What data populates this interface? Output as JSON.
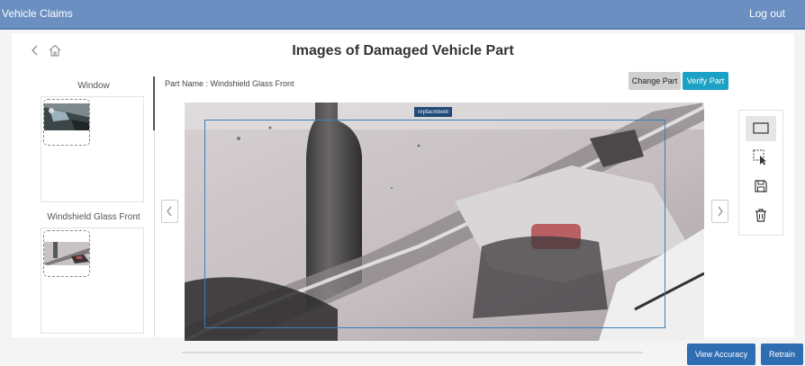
{
  "header": {
    "app_title": "Vehicle Claims",
    "logout_label": "Log out"
  },
  "page": {
    "title": "Images of Damaged Vehicle Part",
    "part_name": "Part Name : Windshield Glass Front"
  },
  "sidebar": {
    "groups": [
      {
        "label": "Window"
      },
      {
        "label": "Windshield Glass Front"
      }
    ]
  },
  "toolbar": {
    "change_part_label": "Change Part",
    "verify_part_label": "Verify Part"
  },
  "annotation": {
    "label": "replacement"
  },
  "tools": [
    {
      "icon": "rectangle-icon",
      "active": true
    },
    {
      "icon": "select-pointer-icon",
      "active": false
    },
    {
      "icon": "save-icon",
      "active": false
    },
    {
      "icon": "trash-icon",
      "active": false
    }
  ],
  "footer": {
    "view_accuracy_label": "View Accuracy",
    "retrain_label": "Retrain"
  },
  "colors": {
    "header_bg": "#6b8fc0",
    "verify_button": "#1ba1c5",
    "footer_button": "#2f6db3",
    "bbox_border": "#3a7fb8"
  }
}
